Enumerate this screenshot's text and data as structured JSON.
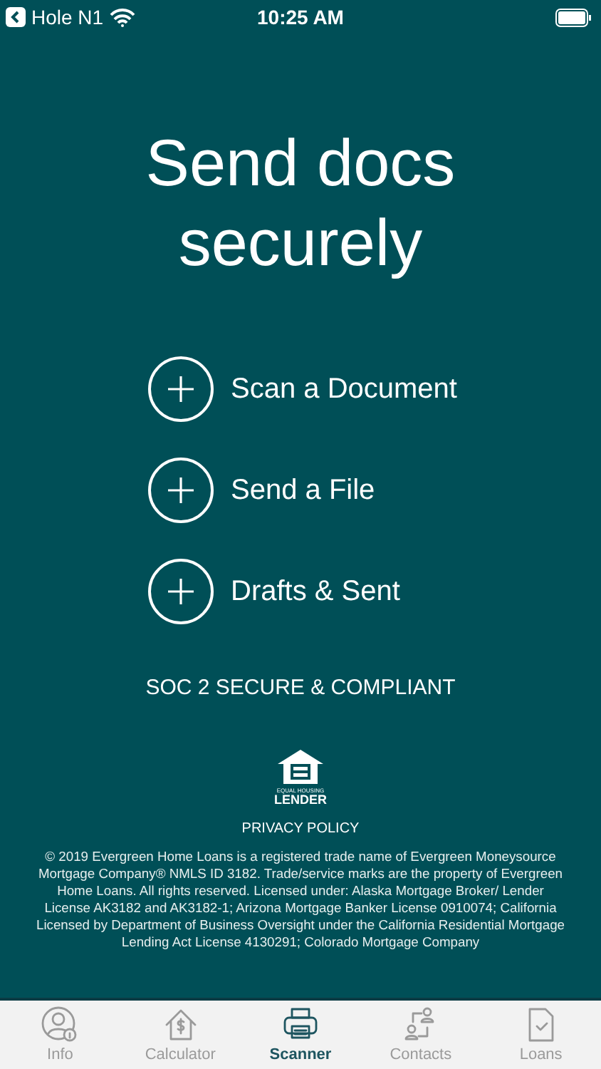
{
  "status_bar": {
    "back_label": "Hole N1",
    "time": "10:25 AM"
  },
  "title": "Send docs securely",
  "actions": [
    {
      "label": "Scan a Document"
    },
    {
      "label": "Send a File"
    },
    {
      "label": "Drafts & Sent"
    }
  ],
  "compliance": "SOC 2 SECURE & COMPLIANT",
  "logo": {
    "top_text": "EQUAL HOUSING",
    "bottom_text": "LENDER"
  },
  "privacy_link": "PRIVACY POLICY",
  "legal": "© 2019 Evergreen Home Loans is a registered trade name of Evergreen Moneysource Mortgage Company® NMLS ID 3182. Trade/service marks are the property of Evergreen Home Loans. All rights reserved. Licensed under: Alaska Mortgage Broker/ Lender License AK3182 and AK3182-1; Arizona Mortgage Banker License 0910074; California Licensed by Department of Business Oversight under the California Residential Mortgage Lending Act License 4130291; Colorado Mortgage Company",
  "tabs": [
    {
      "label": "Info",
      "kind": "info",
      "selected": false
    },
    {
      "label": "Calculator",
      "kind": "calculator",
      "selected": false
    },
    {
      "label": "Scanner",
      "kind": "scanner",
      "selected": true
    },
    {
      "label": "Contacts",
      "kind": "contacts",
      "selected": false
    },
    {
      "label": "Loans",
      "kind": "loans",
      "selected": false
    }
  ]
}
